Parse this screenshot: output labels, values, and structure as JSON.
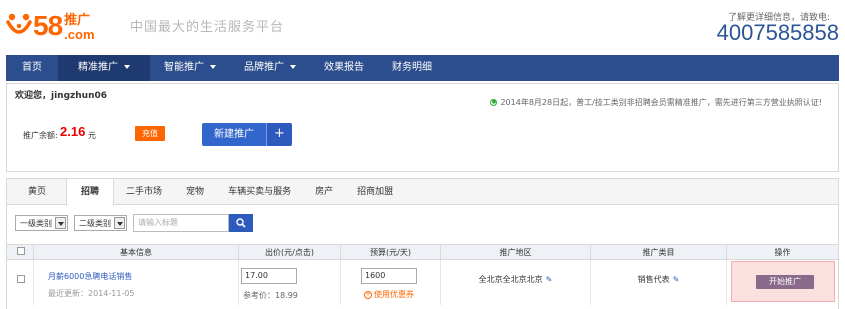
{
  "header": {
    "logo_number": "58",
    "logo_tui": "推广",
    "logo_com": ".com",
    "slogan": "中国最大的生活服务平台",
    "hotline_label": "了解更详细信息，请致电:",
    "hotline": "4007585858"
  },
  "nav": {
    "items": [
      {
        "label": "首页",
        "has_caret": false
      },
      {
        "label": "精准推广",
        "has_caret": true
      },
      {
        "label": "智能推广",
        "has_caret": true
      },
      {
        "label": "品牌推广",
        "has_caret": true
      },
      {
        "label": "效果报告",
        "has_caret": false
      },
      {
        "label": "财务明细",
        "has_caret": false
      }
    ],
    "active_index": 1
  },
  "welcome": {
    "greeting": "欢迎您，jingzhun06",
    "notice": "2014年8月28日起，普工/技工类别非招聘会员需精准推广，需先进行第三方营业执照认证!",
    "balance_label": "推广余额:",
    "balance_value": "2.16",
    "balance_unit": "元",
    "recharge_label": "充值",
    "new_promo_label": "新建推广",
    "new_promo_plus": "+"
  },
  "tabs": {
    "items": [
      "黄页",
      "招聘",
      "二手市场",
      "宠物",
      "车辆买卖与服务",
      "房产",
      "招商加盟"
    ],
    "active_index": 1
  },
  "filters": {
    "level1": "一级类别",
    "level2": "二级类别",
    "search_placeholder": "请输入标题"
  },
  "table": {
    "headers": [
      "",
      "基本信息",
      "出价(元/点击)",
      "预算(元/天)",
      "推广地区",
      "推广类目",
      "操作"
    ],
    "rows": [
      {
        "title": "月薪6000急聘电话销售",
        "updated": "最近更新：2014-11-05",
        "bid": "17.00",
        "ref_price": "参考价：18.99",
        "budget": "1600",
        "coupon": "使用优惠券",
        "region": "全北京全北京北京",
        "category": "销售代表",
        "action": "开始推广"
      }
    ]
  },
  "colors": {
    "brand_orange": "#ff6600",
    "nav_blue": "#2d4e8e",
    "button_blue": "#3366cc",
    "price_red": "#ee0000",
    "highlight_pink": "#fce0e0"
  }
}
